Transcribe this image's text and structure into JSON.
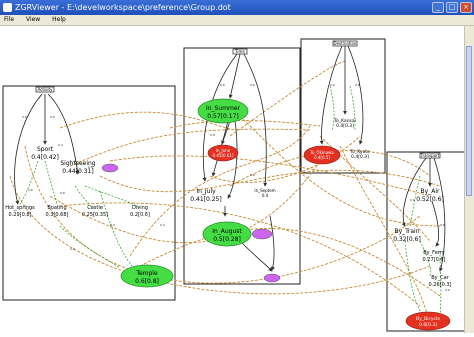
{
  "window": {
    "title": "ZGRViewer - E:\\develworkspace\\preference\\Group.dot",
    "min_glyph": "_",
    "max_glyph": "□",
    "close_glyph": "×"
  },
  "menu": [
    "File",
    "View",
    "Help"
  ],
  "graph": {
    "clusters": [
      "Activity",
      "Time",
      "Destination",
      "Transport"
    ],
    "nodes": {
      "sport": {
        "name": "Sport",
        "value": "0.4[0.42]"
      },
      "sightseeing": {
        "name": "Sightseeing",
        "value": "0.44[0.31]"
      },
      "hot_springs": {
        "name": "Hot_springs",
        "value": "0.29[0.8]"
      },
      "boating": {
        "name": "Boating",
        "value": "0.3[0.68]"
      },
      "castle": {
        "name": "Castle",
        "value": "0.25[0.35]"
      },
      "diving": {
        "name": "Diving",
        "value": "0.2[0.6]"
      },
      "temple": {
        "name": "Temple",
        "value": "0.6[0.8]"
      },
      "in_summer": {
        "name": "In_Summer",
        "value": "0.57[0.17]"
      },
      "in_july": {
        "name": "In_July",
        "value": "0.41[0.25]"
      },
      "in_june": {
        "name": "In_June",
        "value": "0.45[0.61]"
      },
      "in_august": {
        "name": "In_August",
        "value": "0.5[0.28]"
      },
      "in_sept": {
        "name": "In_Septem",
        "value": "0.4"
      },
      "to_kansai": {
        "name": "To_Kansai",
        "value": "0.4[0.3]"
      },
      "to_okinawa": {
        "name": "To_Okinawa",
        "value": "0.4[0.5]"
      },
      "to_kyoto": {
        "name": "To_Kyoto",
        "value": "0.4[0.3]"
      },
      "by_air": {
        "name": "By_Air",
        "value": "0.52[0.6]"
      },
      "by_train": {
        "name": "By_Train",
        "value": "0.32[0.6]"
      },
      "by_ferry": {
        "name": "By_Ferry",
        "value": "0.27[0.6]"
      },
      "by_car": {
        "name": "By_Car",
        "value": "0.26[0.3]"
      },
      "by_bicycle": {
        "name": "By_Bicycle",
        "value": "0.6[0.3]"
      }
    },
    "colors": {
      "green_node": "#44dd44",
      "red_node": "#e33020",
      "violet_node": "#cc66ee",
      "edge_brown": "#c88a30",
      "edge_green": "#33aa33",
      "edge_black": "#222222"
    }
  }
}
